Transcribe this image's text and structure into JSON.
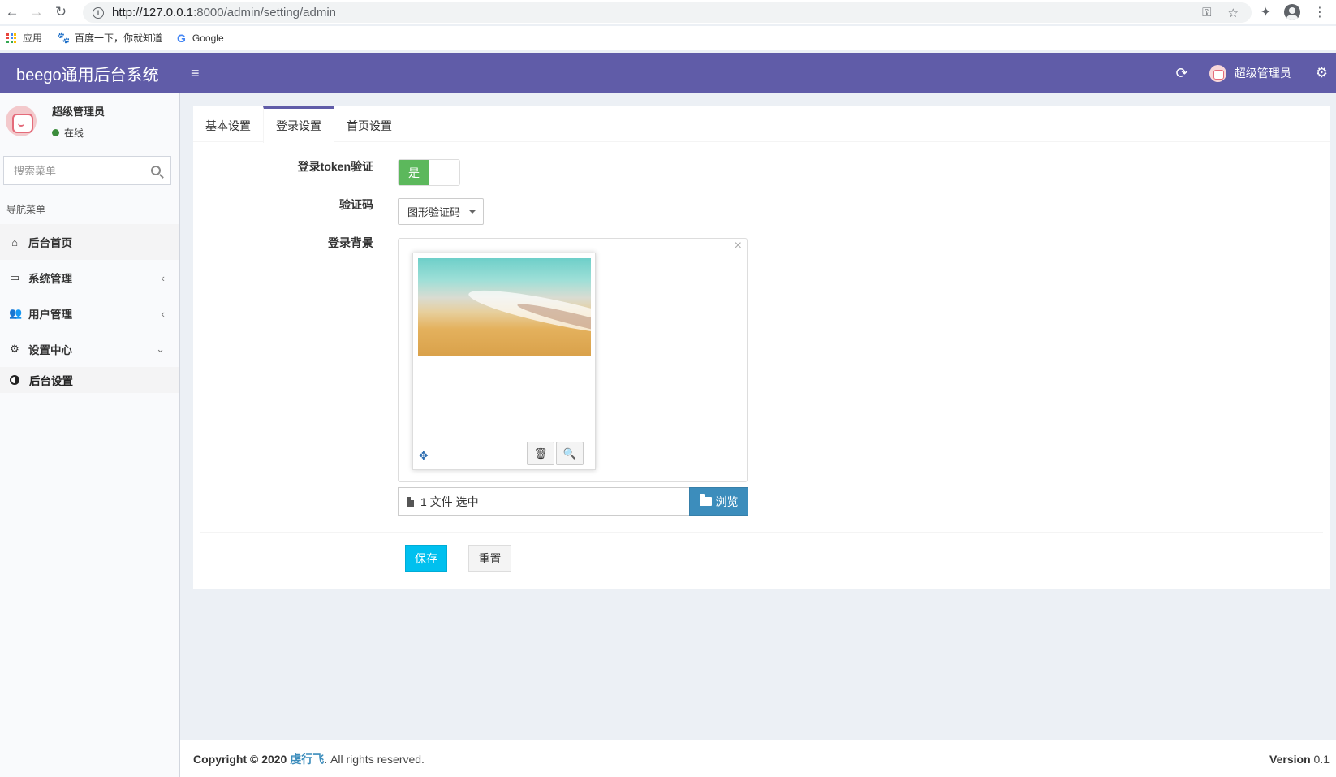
{
  "browser": {
    "url_host": "http://127.0.0.1",
    "url_rest": ":8000/admin/setting/admin",
    "bookmarks": [
      {
        "label": "应用",
        "icon": "apps-grid-icon"
      },
      {
        "label": "百度一下，你就知道",
        "icon": "baidu-paw-icon"
      },
      {
        "label": "Google",
        "icon": "google-g-icon"
      }
    ]
  },
  "header": {
    "logo": "beego通用后台系统",
    "user_name": "超级管理员"
  },
  "sidebar": {
    "user_name": "超级管理员",
    "status": "在线",
    "search_placeholder": "搜索菜单",
    "nav_header": "导航菜单",
    "items": [
      {
        "label": "后台首页",
        "icon": "home-icon"
      },
      {
        "label": "系统管理",
        "icon": "desktop-icon"
      },
      {
        "label": "用户管理",
        "icon": "users-icon"
      },
      {
        "label": "设置中心",
        "icon": "cogs-icon"
      }
    ],
    "sub_item": "后台设置"
  },
  "tabs": [
    "基本设置",
    "登录设置",
    "首页设置"
  ],
  "form": {
    "token_label": "登录token验证",
    "token_value": "是",
    "captcha_label": "验证码",
    "captcha_value": "图形验证码",
    "bg_label": "登录背景",
    "file_caption": "1 文件 选中",
    "browse_label": "浏览",
    "save_label": "保存",
    "reset_label": "重置"
  },
  "footer": {
    "copyright_prefix": "Copyright © 2020",
    "author": "虔行飞",
    "rights": ". All rights reserved.",
    "version_label": "Version",
    "version_value": "0.1"
  },
  "colors": {
    "header_bg": "#605ca8",
    "switch_on": "#5cb85c",
    "save_btn": "#00c0ef",
    "browse_btn": "#3c8dbc"
  }
}
